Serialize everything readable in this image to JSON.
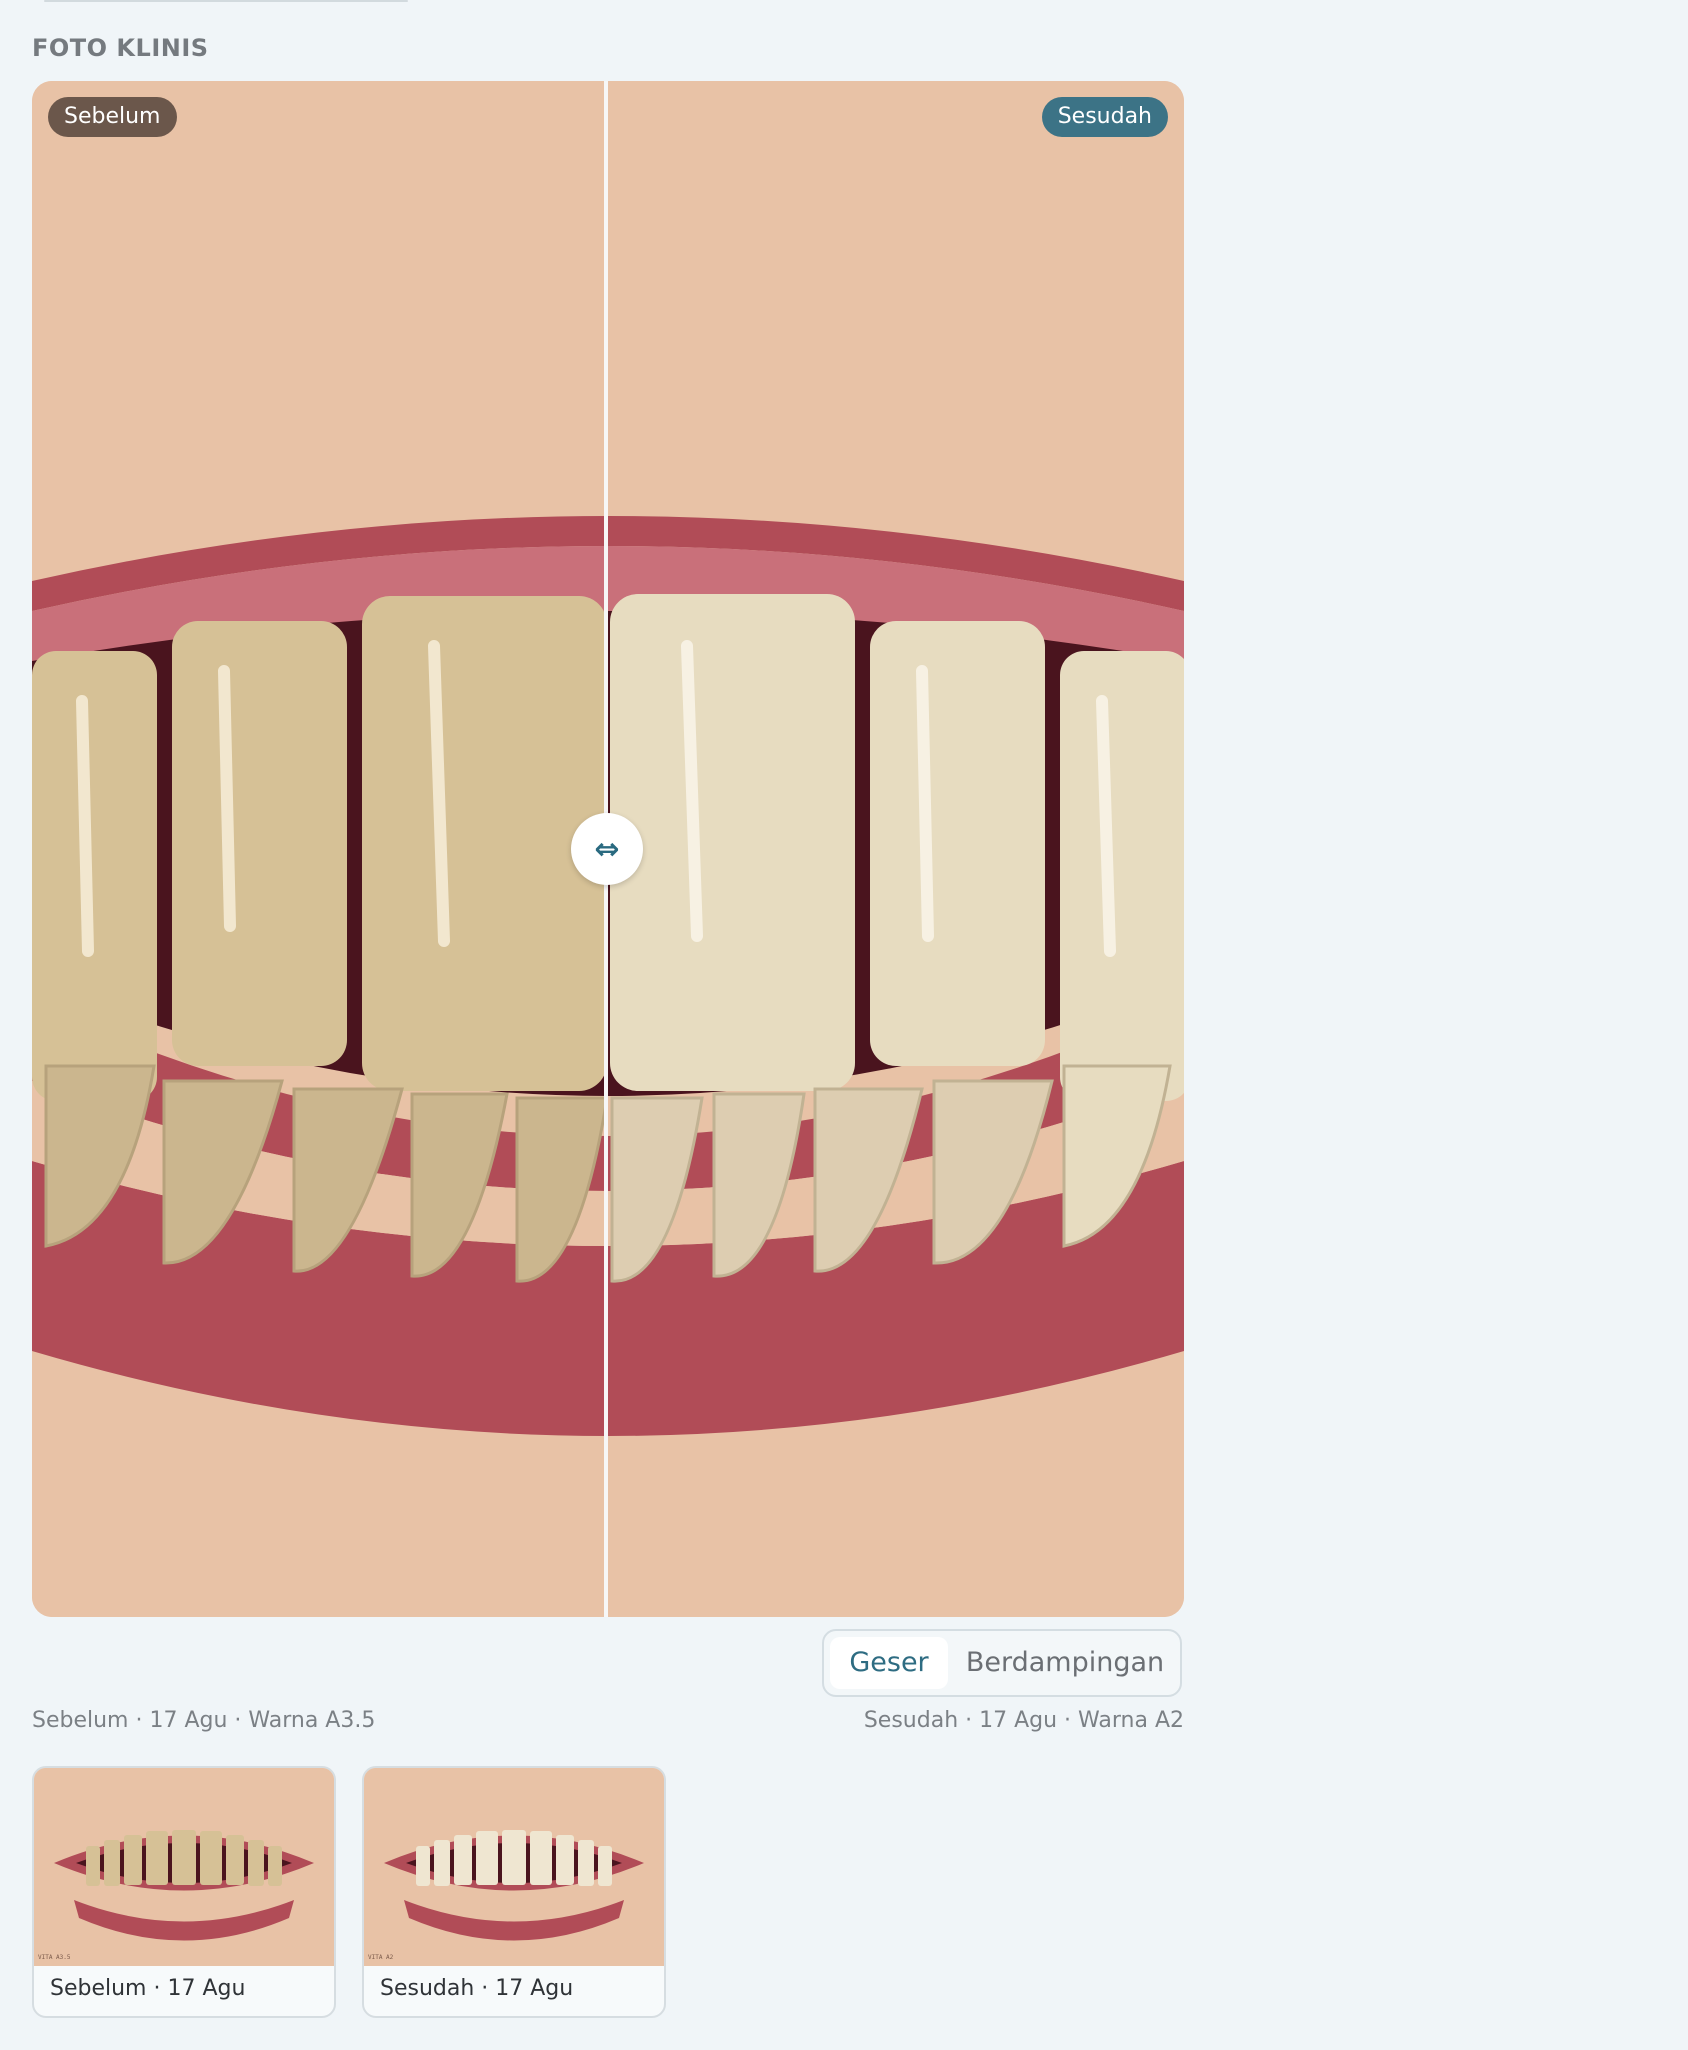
{
  "section": {
    "title": "FOTO KLINIS"
  },
  "viewer": {
    "before_badge": "Sebelum",
    "after_badge": "Sesudah",
    "handle_glyph": "⇔",
    "split_percent": 50
  },
  "modes": {
    "options": [
      "Geser",
      "Berdampingan"
    ],
    "selected": "Geser"
  },
  "captions": {
    "before": "Sebelum · 17 Agu · Warna A3.5",
    "after": "Sesudah · 17 Agu · Warna A2"
  },
  "thumbnails": [
    {
      "label": "Sebelum · 17 Agu",
      "shade_tag": "VITA A3.5"
    },
    {
      "label": "Sesudah · 17 Agu",
      "shade_tag": "VITA A2"
    }
  ],
  "colors": {
    "skin": "#e8c2a6",
    "lip": "#b14c57",
    "gum": "#c9707a",
    "mouth_dark": "#4a141e",
    "tooth_before": "#d6c196",
    "tooth_after": "#e7dcc0",
    "accent": "#3c7386",
    "before_badge": "#6b574b"
  }
}
